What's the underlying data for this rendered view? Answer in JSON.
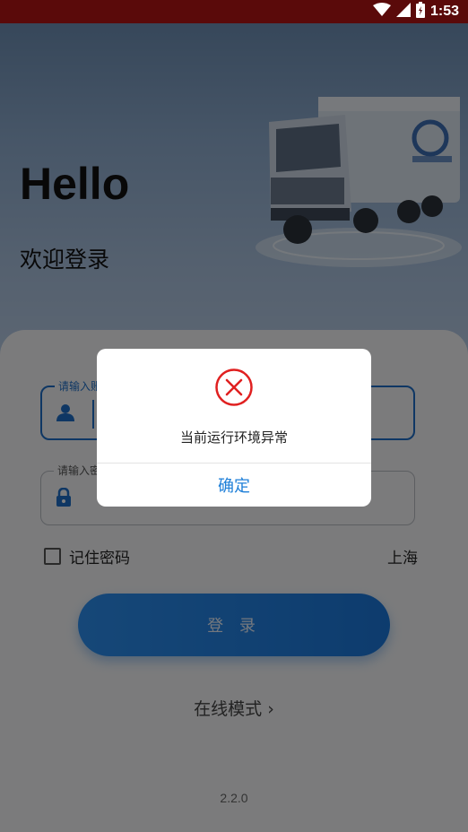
{
  "status_bar": {
    "time": "1:53",
    "icons": [
      "wifi-icon",
      "signal-icon",
      "battery-icon"
    ]
  },
  "hero": {
    "title": "Hello",
    "subtitle": "欢迎登录"
  },
  "form": {
    "username": {
      "label": "请输入账号",
      "value": "",
      "icon": "user-icon"
    },
    "password": {
      "label": "请输入密码",
      "value": "",
      "icon": "lock-icon"
    },
    "remember_label": "记住密码",
    "remember_checked": false,
    "city": "上海",
    "login_label": "登 录",
    "online_mode": "在线模式 ›",
    "version": "2.2.0"
  },
  "dialog": {
    "icon": "error-icon",
    "message": "当前运行环境异常",
    "confirm_label": "确定"
  },
  "colors": {
    "status_bar": "#5a0a0a",
    "accent": "#1e6fc8",
    "button": "#2c8ff0",
    "error": "#e02020"
  }
}
